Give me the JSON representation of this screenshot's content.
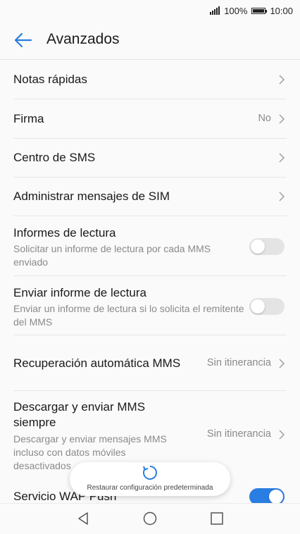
{
  "status": {
    "battery": "100%",
    "time": "10:00",
    "battery_level": 1.0
  },
  "header": {
    "title": "Avanzados"
  },
  "rows": [
    {
      "label": "Notas rápidas"
    },
    {
      "label": "Firma",
      "value": "No"
    },
    {
      "label": "Centro de SMS"
    },
    {
      "label": "Administrar mensajes de SIM"
    },
    {
      "label": "Informes de lectura",
      "sub": "Solicitar un informe de lectura por cada MMS enviado",
      "toggle": false
    },
    {
      "label": "Enviar informe de lectura",
      "sub": "Enviar un informe de lectura si lo solicita el remitente del MMS",
      "toggle": false
    },
    {
      "label": "Recuperación automática MMS",
      "value": "Sin itinerancia"
    },
    {
      "label": "Descargar y enviar MMS siempre",
      "sub": "Descargar y enviar mensajes MMS incluso con datos móviles desactivados",
      "value": "Sin itinerancia"
    },
    {
      "label": "Servicio WAP Push",
      "toggle": true
    }
  ],
  "toast": {
    "message": "Restaurar configuración predeterminada"
  },
  "icons": {
    "back": "arrow-left-icon",
    "chevron": "chevron-right-icon",
    "refresh": "refresh-icon",
    "nav_back": "triangle-back-icon",
    "nav_home": "circle-home-icon",
    "nav_recent": "square-recent-icon"
  },
  "colors": {
    "accent": "#2a7de1",
    "toggle_off": "#e4e4e4",
    "secondary_text": "#8a8a8a"
  }
}
